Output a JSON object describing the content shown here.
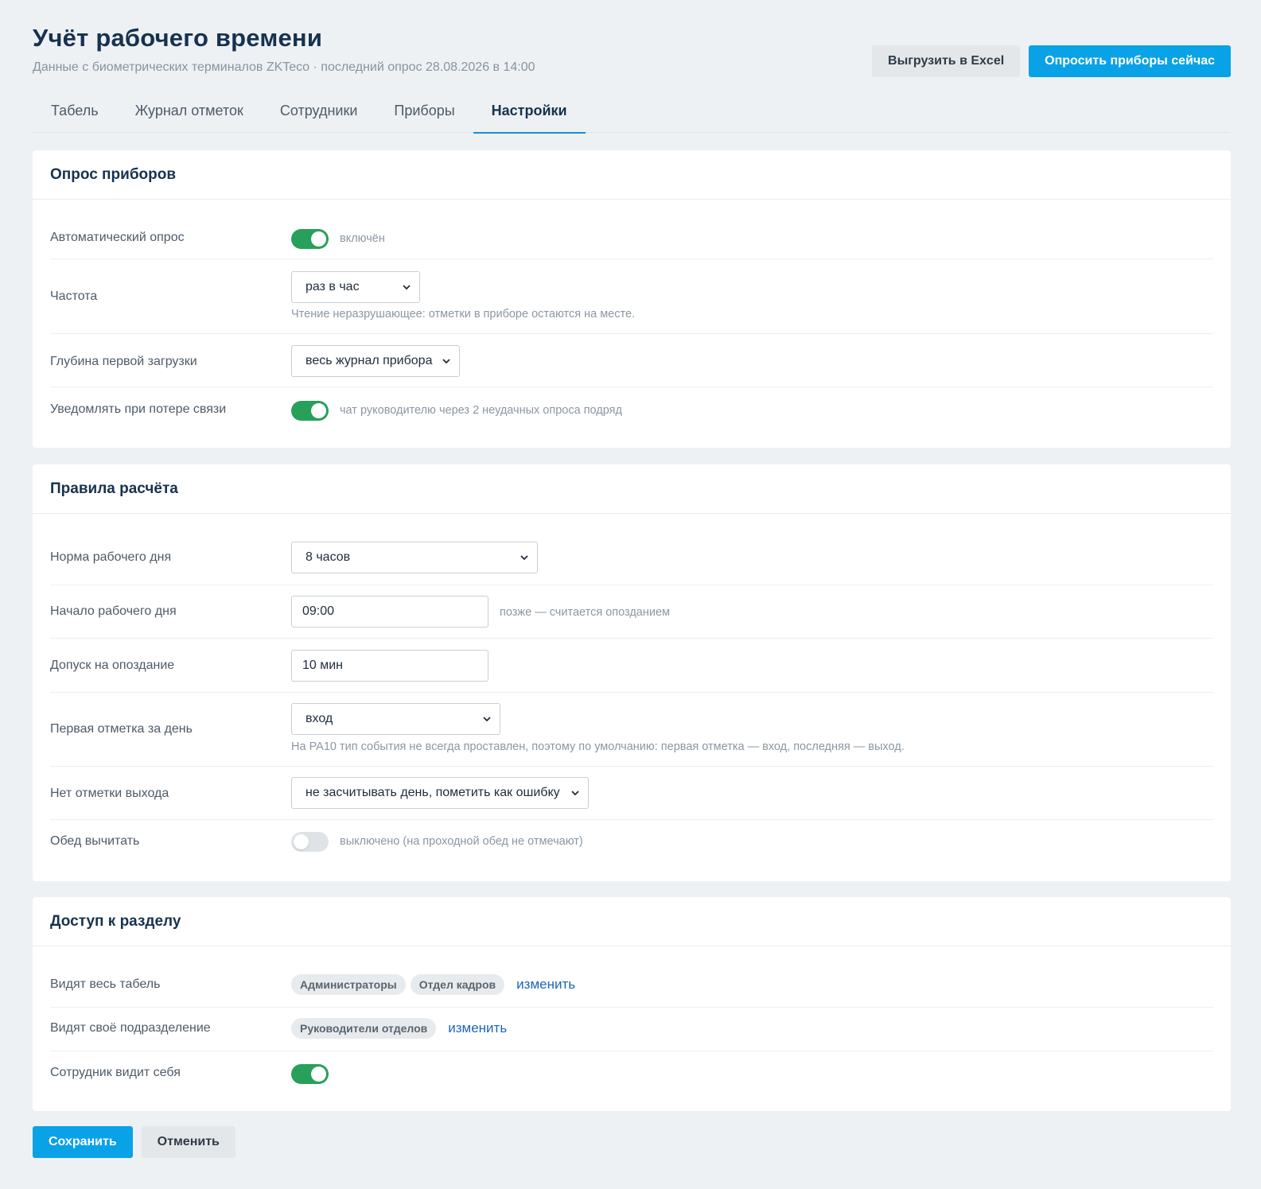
{
  "header": {
    "title": "Учёт рабочего времени",
    "subtitle": "Данные с биометрических терминалов ZKTeco · последний опрос 28.08.2026 в 14:00",
    "export_label": "Выгрузить в Excel",
    "poll_label": "Опросить приборы сейчас"
  },
  "tabs": [
    {
      "label": "Табель",
      "active": false
    },
    {
      "label": "Журнал отметок",
      "active": false
    },
    {
      "label": "Сотрудники",
      "active": false
    },
    {
      "label": "Приборы",
      "active": false
    },
    {
      "label": "Настройки",
      "active": true
    }
  ],
  "polling": {
    "title": "Опрос приборов",
    "auto": {
      "label": "Автоматический опрос",
      "enabled": true,
      "hint": "включён"
    },
    "frequency": {
      "label": "Частота",
      "value": "раз в час",
      "hint": "Чтение неразрушающее: отметки в приборе остаются на месте."
    },
    "depth": {
      "label": "Глубина первой загрузки",
      "value": "весь журнал прибора"
    },
    "notify": {
      "label": "Уведомлять при потере связи",
      "enabled": true,
      "hint": "чат руководителю через 2 неудачных опроса подряд"
    }
  },
  "rules": {
    "title": "Правила расчёта",
    "norm": {
      "label": "Норма рабочего дня",
      "value": "8 часов"
    },
    "start": {
      "label": "Начало рабочего дня",
      "value": "09:00",
      "hint": "позже — считается опозданием"
    },
    "tolerance": {
      "label": "Допуск на опоздание",
      "value": "10 мин"
    },
    "first_mark": {
      "label": "Первая отметка за день",
      "value": "вход",
      "hint": "На PA10 тип события не всегда проставлен, поэтому по умолчанию: первая отметка — вход, последняя — выход."
    },
    "no_exit": {
      "label": "Нет отметки выхода",
      "value": "не засчитывать день, пометить как ошибку"
    },
    "lunch": {
      "label": "Обед вычитать",
      "enabled": false,
      "hint": "выключено (на проходной обед не отмечают)"
    }
  },
  "access": {
    "title": "Доступ к разделу",
    "all": {
      "label": "Видят весь табель",
      "chips": [
        "Администраторы",
        "Отдел кадров"
      ],
      "link": "изменить"
    },
    "dept": {
      "label": "Видят своё подразделение",
      "chips": [
        "Руководители отделов"
      ],
      "link": "изменить"
    },
    "self": {
      "label": "Сотрудник видит себя",
      "enabled": true
    }
  },
  "footer": {
    "save_label": "Сохранить",
    "cancel_label": "Отменить"
  },
  "colors": {
    "accent": "#0aa2e6",
    "toggle_on": "#27a05a",
    "link": "#1d66b8"
  }
}
